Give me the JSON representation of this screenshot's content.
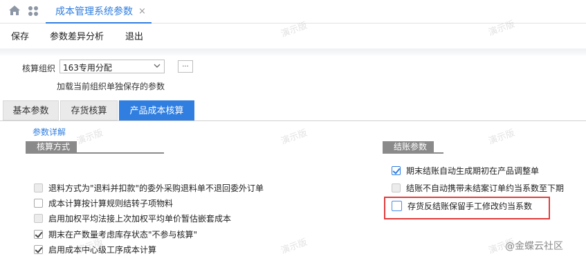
{
  "window": {
    "active_tab": "成本管理系统参数"
  },
  "toolbar": {
    "save": "保存",
    "diff": "参数差异分析",
    "exit": "退出"
  },
  "org": {
    "label": "核算组织",
    "value": "163专用分配",
    "more": "...",
    "hint": "加载当前组织单独保存的参数"
  },
  "tabs": [
    "基本参数",
    "存货核算",
    "产品成本核算"
  ],
  "detail_link": "参数详解",
  "left_section": {
    "title": "核算方式",
    "options": [
      {
        "label": "退料方式为\"退料并扣款\"的委外采购退料单不退回委外订单",
        "checked": false,
        "disabled": true
      },
      {
        "label": "成本计算按计算规则结转子项物料",
        "checked": false,
        "disabled": false
      },
      {
        "label": "启用加权平均法接上次加权平均单价暂估嵌套成本",
        "checked": false,
        "disabled": true
      },
      {
        "label": "期末在产数量考虑库存状态\"不参与核算\"",
        "checked": true,
        "disabled": false
      },
      {
        "label": "启用成本中心级工序成本计算",
        "checked": true,
        "disabled": false
      }
    ]
  },
  "right_section": {
    "title": "结账参数",
    "options": [
      {
        "label": "期末结账自动生成期初在产品调整单",
        "checked": true,
        "disabled": false
      },
      {
        "label": "结账不自动携带未结案订单约当系数至下期",
        "checked": false,
        "disabled": true
      },
      {
        "label": "存货反结账保留手工修改约当系数",
        "checked": false,
        "disabled": false
      }
    ]
  },
  "watermark": "演示版",
  "brand": "@金蝶云社区",
  "colors": {
    "accent": "#2f7ee0",
    "highlight": "#e03b3b"
  }
}
